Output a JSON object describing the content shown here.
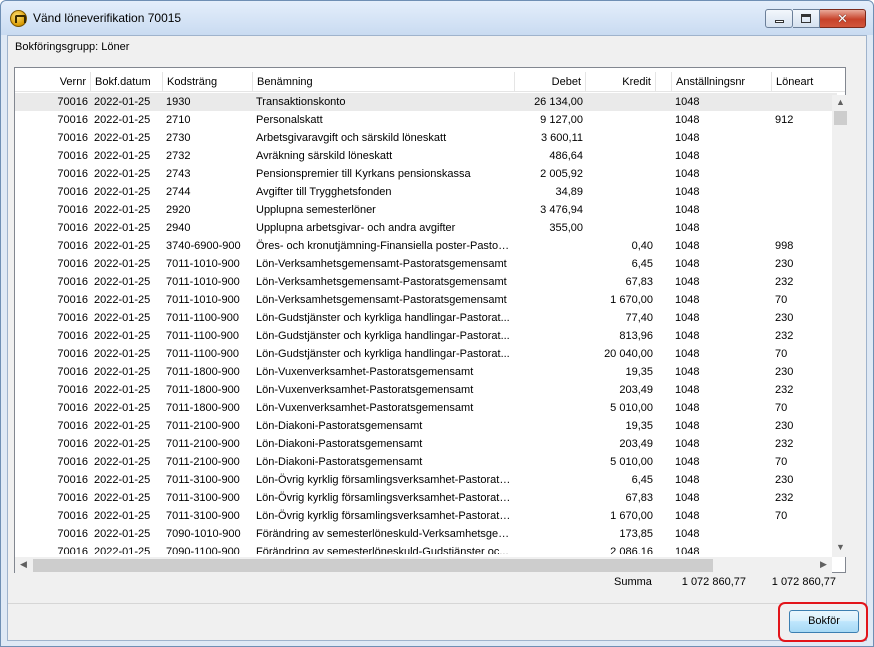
{
  "window": {
    "title": "Vänd löneverifikation 70015",
    "close_glyph": "✕",
    "icon": "app-crown-icon"
  },
  "group": {
    "label": "Bokföringsgrupp: Löner"
  },
  "columns": [
    "Vernr",
    "Bokf.datum",
    "Kodsträng",
    "Benämning",
    "Debet",
    "Kredit",
    "Anställningsnr",
    "Löneart"
  ],
  "rows": [
    {
      "vernr": "70016",
      "datum": "2022-01-25",
      "kod": "1930",
      "benamning": "Transaktionskonto",
      "debet": "26 134,00",
      "kredit": "",
      "anstnr": "1048",
      "loneart": ""
    },
    {
      "vernr": "70016",
      "datum": "2022-01-25",
      "kod": "2710",
      "benamning": "Personalskatt",
      "debet": "9 127,00",
      "kredit": "",
      "anstnr": "1048",
      "loneart": "912"
    },
    {
      "vernr": "70016",
      "datum": "2022-01-25",
      "kod": "2730",
      "benamning": "Arbetsgivaravgift och särskild löneskatt",
      "debet": "3 600,11",
      "kredit": "",
      "anstnr": "1048",
      "loneart": ""
    },
    {
      "vernr": "70016",
      "datum": "2022-01-25",
      "kod": "2732",
      "benamning": "Avräkning särskild löneskatt",
      "debet": "486,64",
      "kredit": "",
      "anstnr": "1048",
      "loneart": ""
    },
    {
      "vernr": "70016",
      "datum": "2022-01-25",
      "kod": "2743",
      "benamning": "Pensionspremier till Kyrkans pensionskassa",
      "debet": "2 005,92",
      "kredit": "",
      "anstnr": "1048",
      "loneart": ""
    },
    {
      "vernr": "70016",
      "datum": "2022-01-25",
      "kod": "2744",
      "benamning": "Avgifter till Trygghetsfonden",
      "debet": "34,89",
      "kredit": "",
      "anstnr": "1048",
      "loneart": ""
    },
    {
      "vernr": "70016",
      "datum": "2022-01-25",
      "kod": "2920",
      "benamning": "Upplupna semesterlöner",
      "debet": "3 476,94",
      "kredit": "",
      "anstnr": "1048",
      "loneart": ""
    },
    {
      "vernr": "70016",
      "datum": "2022-01-25",
      "kod": "2940",
      "benamning": "Upplupna arbetsgivar- och andra avgifter",
      "debet": "355,00",
      "kredit": "",
      "anstnr": "1048",
      "loneart": ""
    },
    {
      "vernr": "70016",
      "datum": "2022-01-25",
      "kod": "3740-6900-900",
      "benamning": "Öres- och kronutjämning-Finansiella poster-Pastorat...",
      "debet": "",
      "kredit": "0,40",
      "anstnr": "1048",
      "loneart": "998"
    },
    {
      "vernr": "70016",
      "datum": "2022-01-25",
      "kod": "7011-1010-900",
      "benamning": "Lön-Verksamhetsgemensamt-Pastoratsgemensamt",
      "debet": "",
      "kredit": "6,45",
      "anstnr": "1048",
      "loneart": "230"
    },
    {
      "vernr": "70016",
      "datum": "2022-01-25",
      "kod": "7011-1010-900",
      "benamning": "Lön-Verksamhetsgemensamt-Pastoratsgemensamt",
      "debet": "",
      "kredit": "67,83",
      "anstnr": "1048",
      "loneart": "232"
    },
    {
      "vernr": "70016",
      "datum": "2022-01-25",
      "kod": "7011-1010-900",
      "benamning": "Lön-Verksamhetsgemensamt-Pastoratsgemensamt",
      "debet": "",
      "kredit": "1 670,00",
      "anstnr": "1048",
      "loneart": "70"
    },
    {
      "vernr": "70016",
      "datum": "2022-01-25",
      "kod": "7011-1100-900",
      "benamning": "Lön-Gudstjänster och kyrkliga handlingar-Pastorat...",
      "debet": "",
      "kredit": "77,40",
      "anstnr": "1048",
      "loneart": "230"
    },
    {
      "vernr": "70016",
      "datum": "2022-01-25",
      "kod": "7011-1100-900",
      "benamning": "Lön-Gudstjänster och kyrkliga handlingar-Pastorat...",
      "debet": "",
      "kredit": "813,96",
      "anstnr": "1048",
      "loneart": "232"
    },
    {
      "vernr": "70016",
      "datum": "2022-01-25",
      "kod": "7011-1100-900",
      "benamning": "Lön-Gudstjänster och kyrkliga handlingar-Pastorat...",
      "debet": "",
      "kredit": "20 040,00",
      "anstnr": "1048",
      "loneart": "70"
    },
    {
      "vernr": "70016",
      "datum": "2022-01-25",
      "kod": "7011-1800-900",
      "benamning": "Lön-Vuxenverksamhet-Pastoratsgemensamt",
      "debet": "",
      "kredit": "19,35",
      "anstnr": "1048",
      "loneart": "230"
    },
    {
      "vernr": "70016",
      "datum": "2022-01-25",
      "kod": "7011-1800-900",
      "benamning": "Lön-Vuxenverksamhet-Pastoratsgemensamt",
      "debet": "",
      "kredit": "203,49",
      "anstnr": "1048",
      "loneart": "232"
    },
    {
      "vernr": "70016",
      "datum": "2022-01-25",
      "kod": "7011-1800-900",
      "benamning": "Lön-Vuxenverksamhet-Pastoratsgemensamt",
      "debet": "",
      "kredit": "5 010,00",
      "anstnr": "1048",
      "loneart": "70"
    },
    {
      "vernr": "70016",
      "datum": "2022-01-25",
      "kod": "7011-2100-900",
      "benamning": "Lön-Diakoni-Pastoratsgemensamt",
      "debet": "",
      "kredit": "19,35",
      "anstnr": "1048",
      "loneart": "230"
    },
    {
      "vernr": "70016",
      "datum": "2022-01-25",
      "kod": "7011-2100-900",
      "benamning": "Lön-Diakoni-Pastoratsgemensamt",
      "debet": "",
      "kredit": "203,49",
      "anstnr": "1048",
      "loneart": "232"
    },
    {
      "vernr": "70016",
      "datum": "2022-01-25",
      "kod": "7011-2100-900",
      "benamning": "Lön-Diakoni-Pastoratsgemensamt",
      "debet": "",
      "kredit": "5 010,00",
      "anstnr": "1048",
      "loneart": "70"
    },
    {
      "vernr": "70016",
      "datum": "2022-01-25",
      "kod": "7011-3100-900",
      "benamning": "Lön-Övrig kyrklig församlingsverksamhet-Pastorats...",
      "debet": "",
      "kredit": "6,45",
      "anstnr": "1048",
      "loneart": "230"
    },
    {
      "vernr": "70016",
      "datum": "2022-01-25",
      "kod": "7011-3100-900",
      "benamning": "Lön-Övrig kyrklig församlingsverksamhet-Pastorats...",
      "debet": "",
      "kredit": "67,83",
      "anstnr": "1048",
      "loneart": "232"
    },
    {
      "vernr": "70016",
      "datum": "2022-01-25",
      "kod": "7011-3100-900",
      "benamning": "Lön-Övrig kyrklig församlingsverksamhet-Pastorats...",
      "debet": "",
      "kredit": "1 670,00",
      "anstnr": "1048",
      "loneart": "70"
    },
    {
      "vernr": "70016",
      "datum": "2022-01-25",
      "kod": "7090-1010-900",
      "benamning": "Förändring av semesterlöneskuld-Verksamhetsgem...",
      "debet": "",
      "kredit": "173,85",
      "anstnr": "1048",
      "loneart": ""
    },
    {
      "vernr": "70016",
      "datum": "2022-01-25",
      "kod": "7090-1100-900",
      "benamning": "Förändring av semesterlöneskuld-Gudstjänster oc...",
      "debet": "",
      "kredit": "2 086,16",
      "anstnr": "1048",
      "loneart": ""
    }
  ],
  "summary": {
    "label": "Summa",
    "debet": "1 072 860,77",
    "kredit": "1 072 860,77"
  },
  "scroll": {
    "up": "▲",
    "down": "▼",
    "left": "◀",
    "right": "▶"
  },
  "actions": {
    "bokfor_label": "Bokför"
  },
  "colors": {
    "highlight": "#e2141a",
    "selected_row": "#eaeaea"
  }
}
